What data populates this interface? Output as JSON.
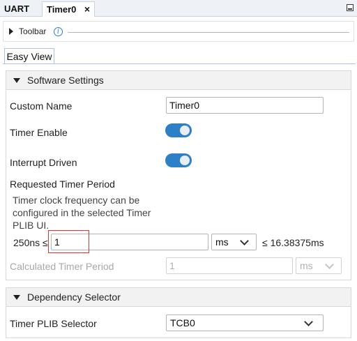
{
  "tabs": [
    {
      "label": "UART",
      "active": false
    },
    {
      "label": "Timer0",
      "active": true,
      "close": "×"
    }
  ],
  "toolbar": {
    "label": "Toolbar",
    "info_icon": "info-icon"
  },
  "view_tab": {
    "label": "Easy View"
  },
  "software_settings": {
    "title": "Software Settings",
    "custom_name_label": "Custom Name",
    "custom_name_value": "Timer0",
    "timer_enable_label": "Timer Enable",
    "timer_enable_on": true,
    "interrupt_driven_label": "Interrupt Driven",
    "interrupt_driven_on": true,
    "requested_period_label": "Requested Timer Period",
    "note_text": "Timer clock frequency can be configured in the selected Timer PLIB UI.",
    "min_label": "250ns ≤",
    "period_value": "1",
    "unit_value": "ms",
    "max_label": "≤ 16.38375ms",
    "calculated_label": "Calculated Timer Period",
    "calculated_value": "1",
    "calculated_unit": "ms"
  },
  "dependency_selector": {
    "title": "Dependency Selector",
    "plib_label": "Timer PLIB Selector",
    "plib_value": "TCB0"
  },
  "colors": {
    "accent": "#2d7fc6",
    "highlight": "#e03232"
  }
}
